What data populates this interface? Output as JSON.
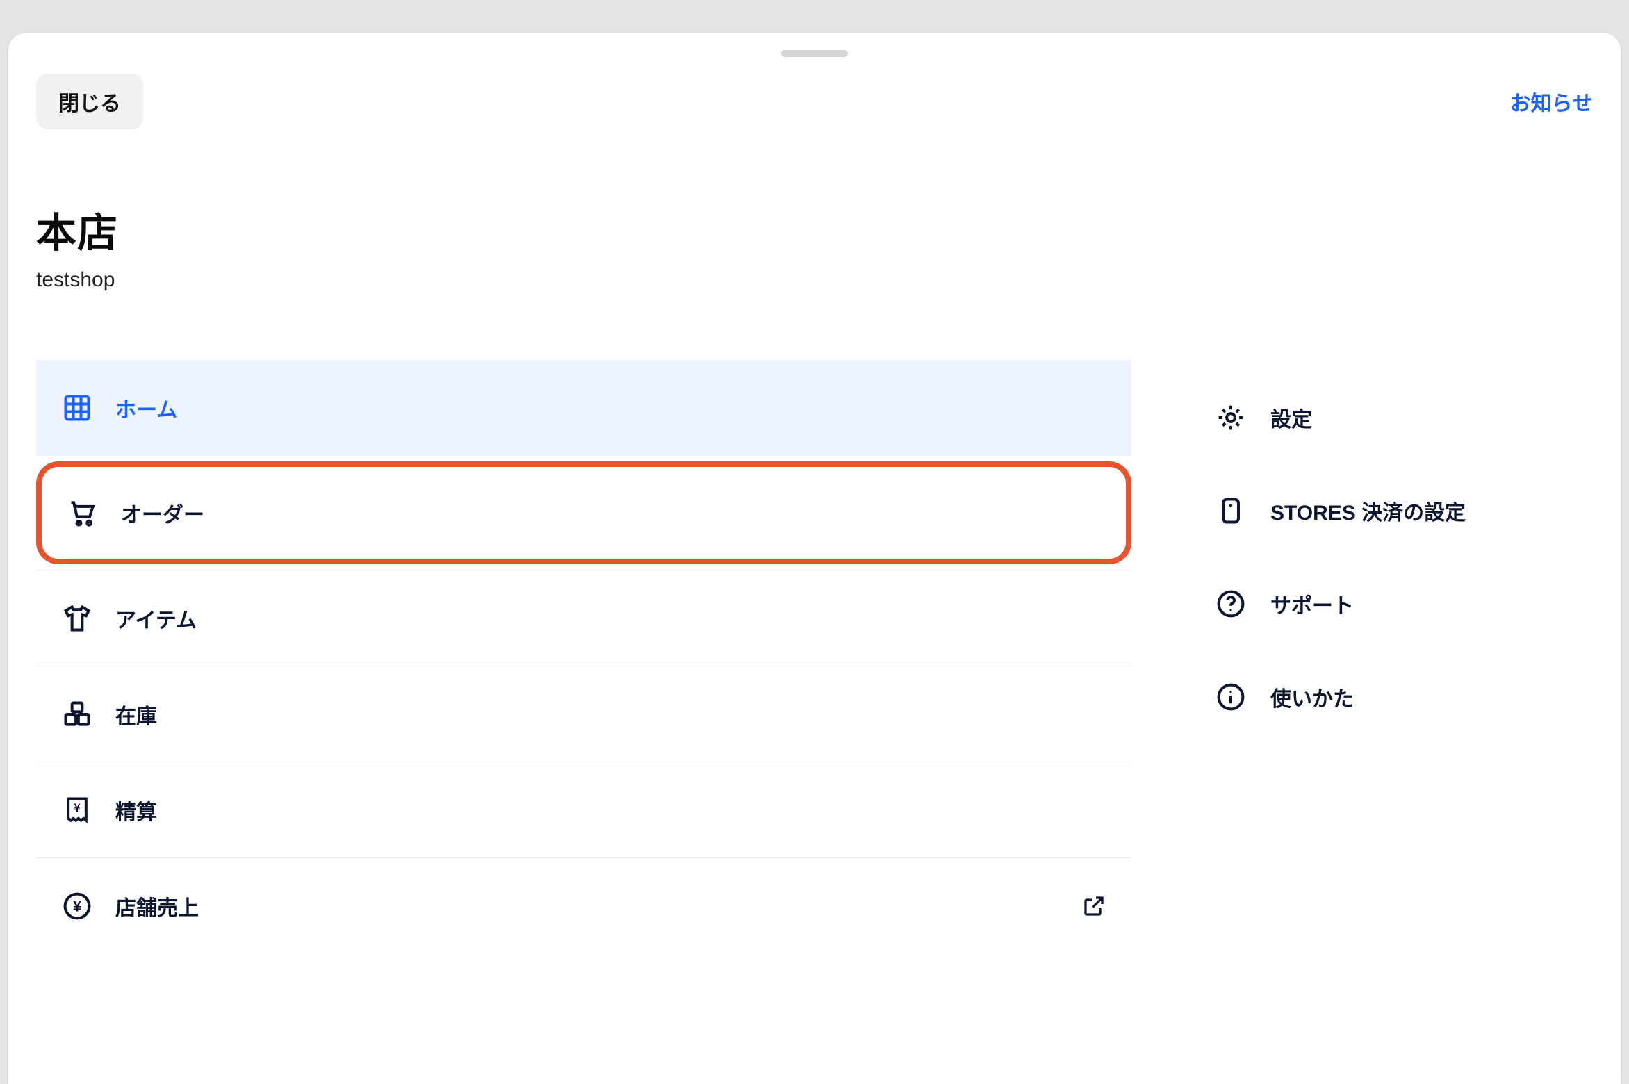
{
  "topbar": {
    "close_label": "閉じる",
    "notice_label": "お知らせ"
  },
  "store": {
    "title": "本店",
    "subtitle": "testshop"
  },
  "menu": {
    "items": [
      {
        "icon": "grid-icon",
        "label": "ホーム",
        "active": true,
        "highlighted": false,
        "external": false
      },
      {
        "icon": "cart-icon",
        "label": "オーダー",
        "active": false,
        "highlighted": true,
        "external": false
      },
      {
        "icon": "shirt-icon",
        "label": "アイテム",
        "active": false,
        "highlighted": false,
        "external": false
      },
      {
        "icon": "box-icon",
        "label": "在庫",
        "active": false,
        "highlighted": false,
        "external": false
      },
      {
        "icon": "receipt-icon",
        "label": "精算",
        "active": false,
        "highlighted": false,
        "external": false
      },
      {
        "icon": "yen-icon",
        "label": "店舗売上",
        "active": false,
        "highlighted": false,
        "external": true
      }
    ]
  },
  "side": {
    "items": [
      {
        "icon": "gear-icon",
        "label": "設定"
      },
      {
        "icon": "terminal-icon",
        "label": "STORES 決済の設定"
      },
      {
        "icon": "help-icon",
        "label": "サポート"
      },
      {
        "icon": "info-icon",
        "label": "使いかた"
      }
    ]
  },
  "colors": {
    "accent": "#1b62ff",
    "highlight_border": "#e8522d",
    "text": "#0c1630"
  }
}
